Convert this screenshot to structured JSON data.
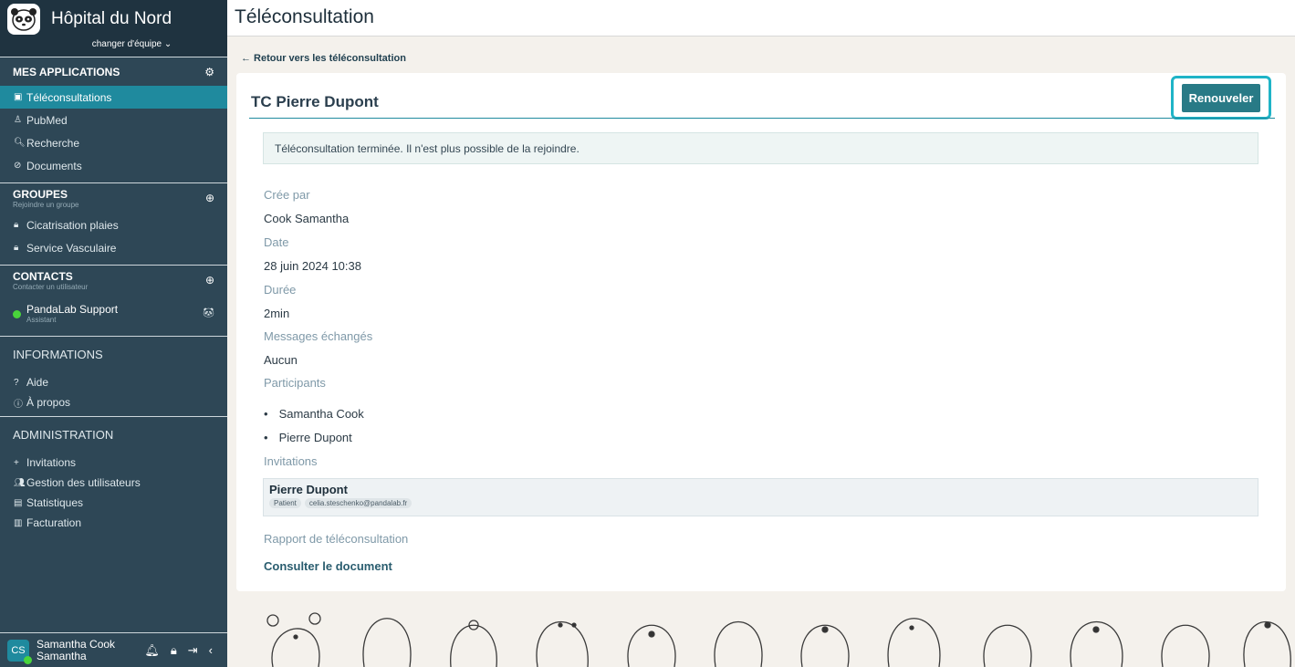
{
  "sidebar": {
    "brand": "Hôpital du Nord",
    "team_switch": "changer d'équipe",
    "apps_title": "MES APPLICATIONS",
    "apps": [
      {
        "label": "Téléconsultations",
        "icon": "calendar-icon"
      },
      {
        "label": "PubMed",
        "icon": "pubmed-icon"
      },
      {
        "label": "Recherche",
        "icon": "search-icon"
      },
      {
        "label": "Documents",
        "icon": "paperclip-icon"
      }
    ],
    "groups_title": "GROUPES",
    "groups_sub": "Rejoindre un groupe",
    "groups": [
      {
        "label": "Cicatrisation plaies",
        "icon": "lock-icon"
      },
      {
        "label": "Service Vasculaire",
        "icon": "lock-icon"
      }
    ],
    "contacts_title": "CONTACTS",
    "contacts_sub": "Contacter un utilisateur",
    "contacts": [
      {
        "name": "PandaLab Support",
        "role": "Assistant"
      }
    ],
    "info_title": "INFORMATIONS",
    "info": [
      {
        "label": "Aide",
        "icon": "question-icon"
      },
      {
        "label": "À propos",
        "icon": "info-icon"
      }
    ],
    "admin_title": "ADMINISTRATION",
    "admin": [
      {
        "label": "Invitations",
        "icon": "plus-icon"
      },
      {
        "label": "Gestion des utilisateurs",
        "icon": "users-icon"
      },
      {
        "label": "Statistiques",
        "icon": "stats-icon"
      },
      {
        "label": "Facturation",
        "icon": "invoice-icon"
      }
    ],
    "user": {
      "initials": "CS",
      "name_line1": "Samantha Cook",
      "name_line2": "Samantha"
    }
  },
  "header": {
    "title": "Téléconsultation"
  },
  "back_link": "← Retour vers les téléconsultation",
  "card": {
    "title": "TC Pierre Dupont",
    "renew_label": "Renouveler",
    "notice": "Téléconsultation terminée. Il n'est plus possible de la rejoindre.",
    "created_by_label": "Crée par",
    "created_by": "Cook Samantha",
    "date_label": "Date",
    "date": "28 juin 2024 10:38",
    "duration_label": "Durée",
    "duration": "2min",
    "messages_label": "Messages échangés",
    "messages": "Aucun",
    "participants_label": "Participants",
    "participants": [
      "Samantha Cook",
      "Pierre Dupont"
    ],
    "invitations_label": "Invitations",
    "invitation": {
      "name": "Pierre Dupont",
      "role": "Patient",
      "email": "celia.steschenko@pandalab.fr"
    },
    "report_label": "Rapport de téléconsultation",
    "report_link": "Consulter le document"
  },
  "colors": {
    "accent": "#1f8a9e",
    "sidebar": "#2e4756",
    "renew_button": "#287a86",
    "focus_ring": "#1fb4c7"
  }
}
